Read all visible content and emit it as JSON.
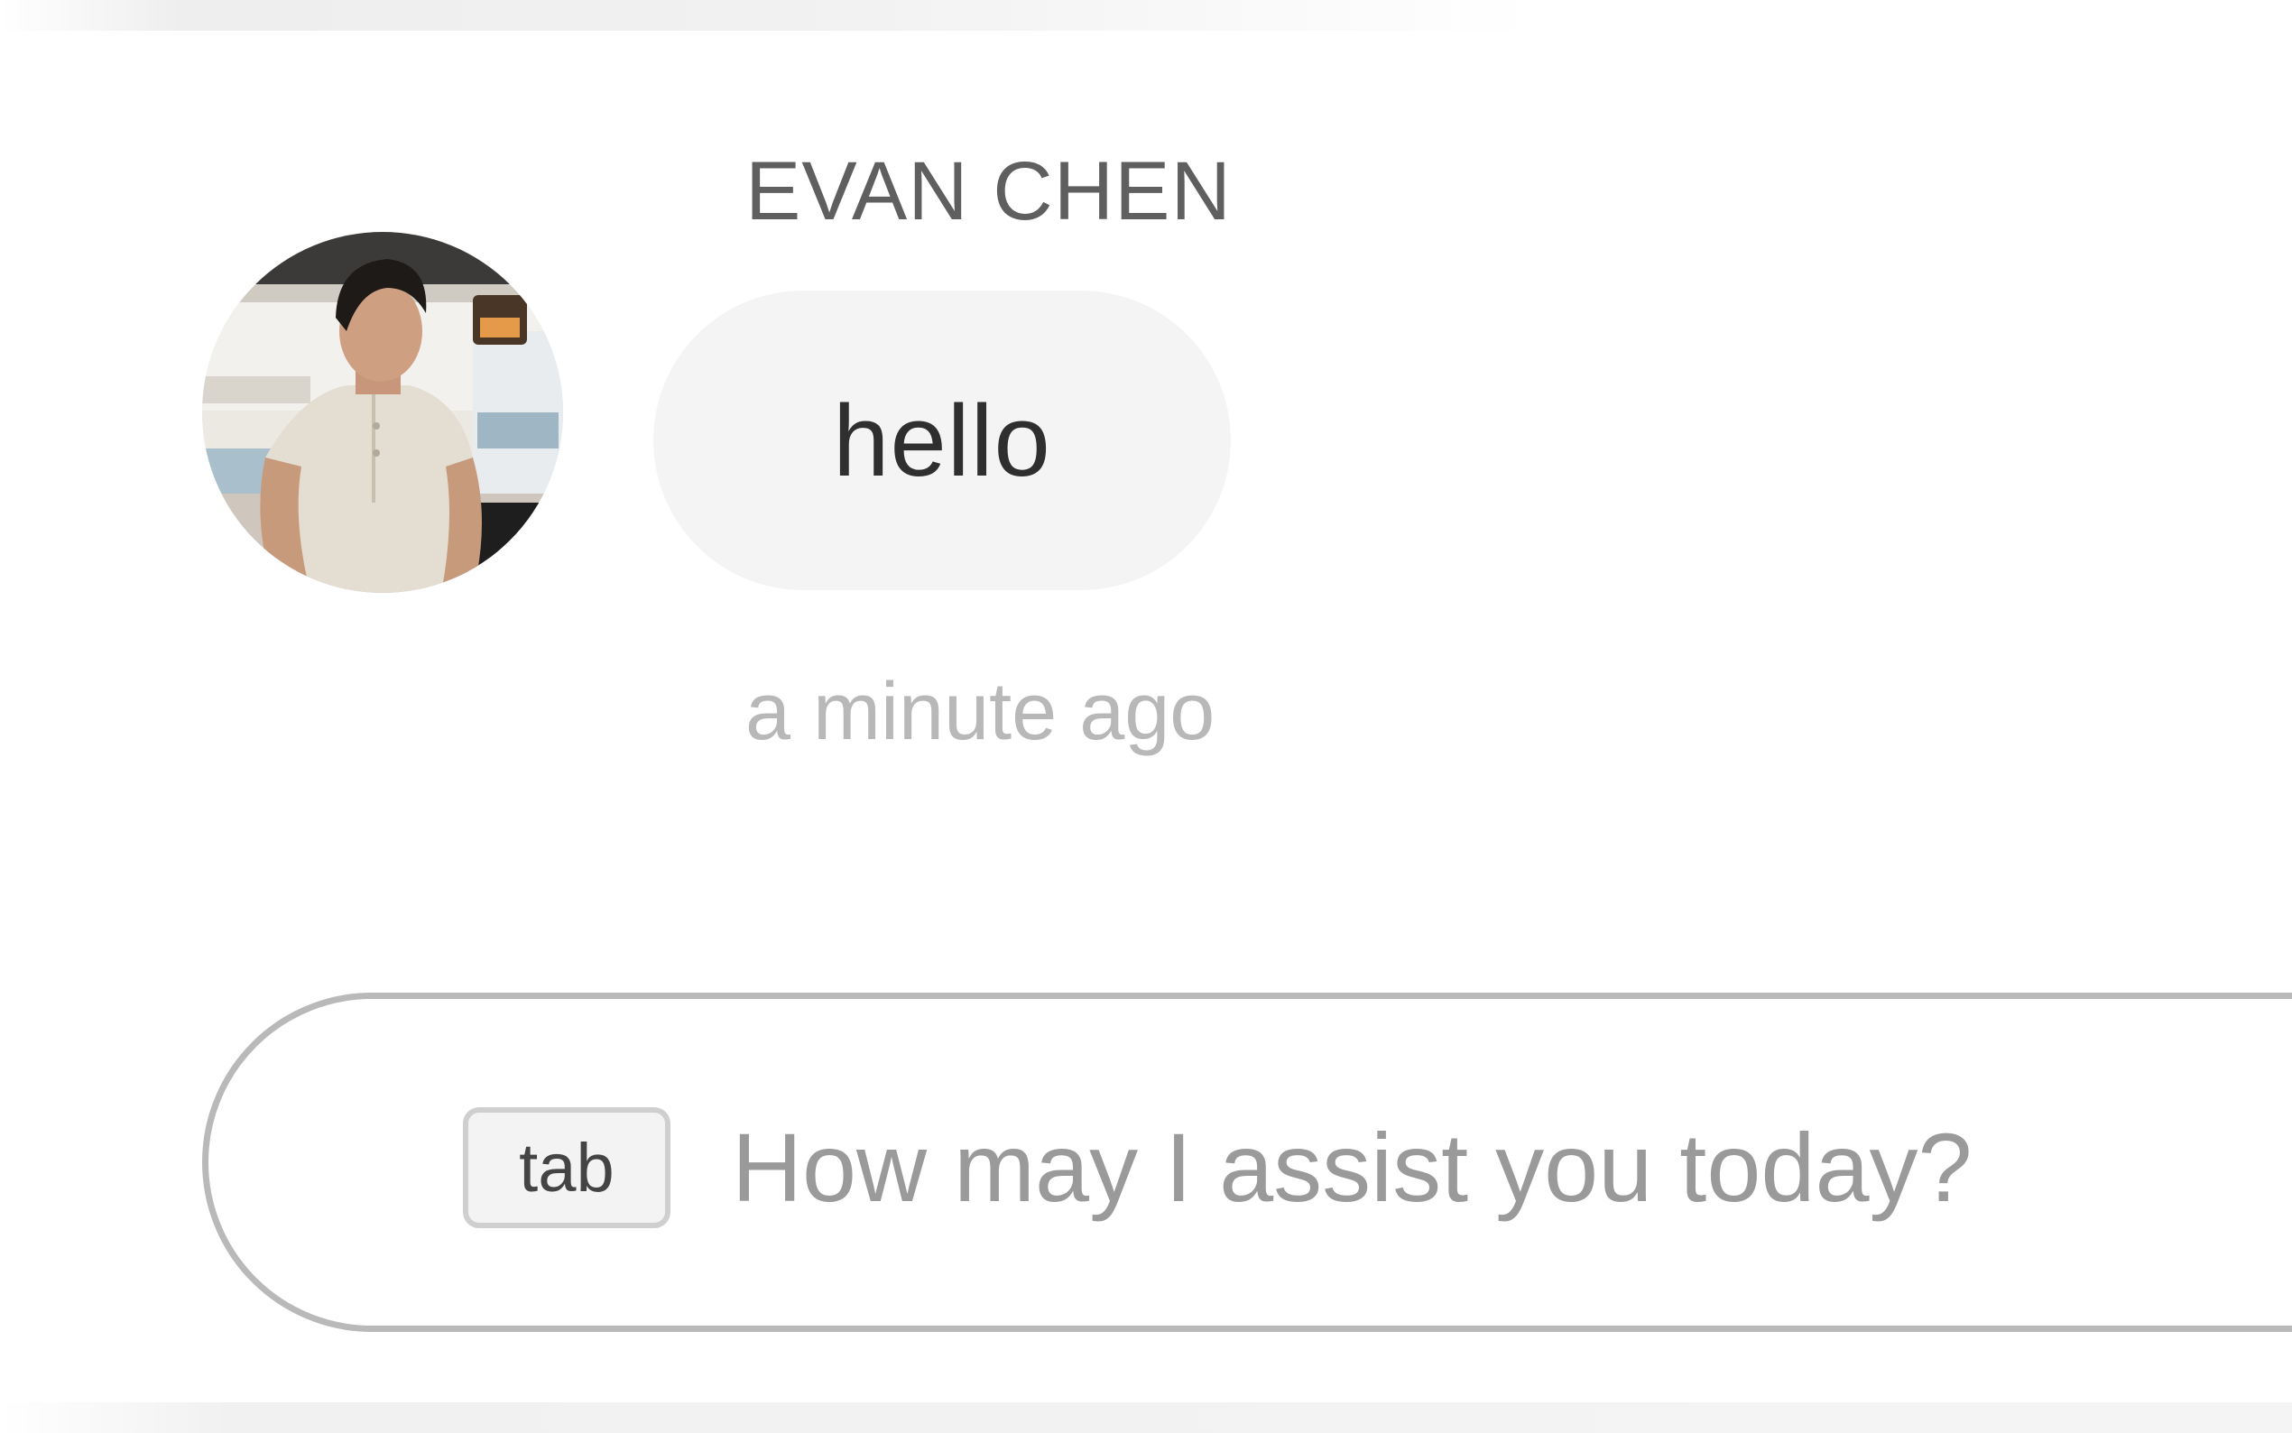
{
  "message": {
    "sender_name": "EVAN CHEN",
    "text": "hello",
    "timestamp": "a minute ago",
    "avatar_icon": "user-photo-avatar"
  },
  "composer": {
    "shortcut_key_label": "tab",
    "placeholder": "How may I assist you today?",
    "value": ""
  },
  "colors": {
    "bubble_background": "#f4f4f4",
    "name_text": "#5f5f5f",
    "timestamp_text": "#b8b8b8",
    "composer_border": "#b9b9b9",
    "placeholder_text": "#9a9a9a"
  }
}
